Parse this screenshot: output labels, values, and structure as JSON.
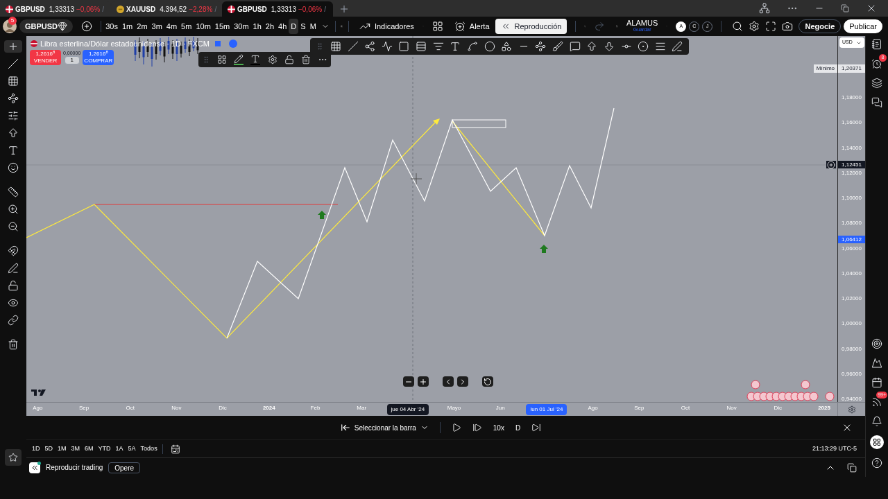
{
  "browser_tabs": [
    {
      "symbol": "GBPUSD",
      "kind": "forex",
      "price": "1,33313",
      "change": "−0,06%",
      "suffix": "/",
      "selected": false
    },
    {
      "symbol": "XAUUSD",
      "kind": "metal",
      "price": "4.394,52",
      "change": "−2,28%",
      "suffix": "/",
      "selected": false
    },
    {
      "symbol": "GBPUSD",
      "kind": "forex",
      "price": "1,33313",
      "change": "−0,06%",
      "suffix": "/",
      "selected": true
    }
  ],
  "toolbar": {
    "avatar_badge": "5",
    "symbol": "GBPUSD",
    "intervals": [
      {
        "label": "30s",
        "selected": false
      },
      {
        "label": "1m",
        "selected": false
      },
      {
        "label": "2m",
        "selected": false
      },
      {
        "label": "3m",
        "selected": false
      },
      {
        "label": "4m",
        "selected": false
      },
      {
        "label": "5m",
        "selected": false
      },
      {
        "label": "10m",
        "selected": false
      },
      {
        "label": "15m",
        "selected": false
      },
      {
        "label": "30m",
        "selected": false
      },
      {
        "label": "1h",
        "selected": false
      },
      {
        "label": "2h",
        "selected": false
      },
      {
        "label": "4h",
        "selected": false
      },
      {
        "label": "D",
        "selected": true
      },
      {
        "label": "S",
        "selected": false
      },
      {
        "label": "M",
        "selected": false
      }
    ],
    "indicators": "Indicadores",
    "alert": "Alerta",
    "replay": "Reproducción",
    "layout_name": "ALAMUS",
    "layout_status": "Guardar",
    "profiles": [
      {
        "label": "A",
        "selected": true
      },
      {
        "label": "C",
        "selected": false
      },
      {
        "label": "J",
        "selected": false
      }
    ],
    "trade": "Negocie",
    "publish": "Publicar"
  },
  "left_tools": [
    {
      "kind": "crosshair",
      "selected": true
    },
    {
      "kind": "line",
      "selected": false
    },
    {
      "kind": "grid",
      "selected": false
    },
    {
      "kind": "pattern",
      "selected": false
    },
    {
      "kind": "sliders",
      "selected": false
    },
    {
      "kind": "arrow",
      "selected": false
    },
    {
      "kind": "text",
      "selected": false
    },
    {
      "kind": "smile",
      "selected": false
    },
    {
      "kind": "ruler",
      "selected": false
    },
    {
      "kind": "zoom_in",
      "selected": false
    },
    {
      "kind": "zoom_out",
      "selected": false
    },
    {
      "kind": "magnet",
      "selected": false
    },
    {
      "kind": "pencil",
      "selected": false
    },
    {
      "kind": "lock",
      "selected": false
    },
    {
      "kind": "eye",
      "selected": false
    },
    {
      "kind": "link",
      "selected": false
    },
    {
      "kind": "trash",
      "selected": false
    }
  ],
  "legend": {
    "title": "Libra esterlina/Dólar estadounidense · 1D · FXCM",
    "sell_price": "1,2616$^{8}$",
    "sell_label": "VENDER",
    "spread": "0,00000",
    "quantity": "1",
    "buy_price": "1,2616$^{8}$",
    "buy_label": "COMPRAR"
  },
  "price_axis": {
    "currency": "USD",
    "min_label": "Mínimo",
    "min_value": "1,20371",
    "ticks": [
      "1,18000",
      "1,16000",
      "1,14000",
      "1,12000",
      "1,10000",
      "1,08000",
      "1,06000",
      "1,04000",
      "1,02000",
      "1,00000",
      "0,98000",
      "0,96000",
      "0,94000"
    ],
    "cursor_value": "1,12451",
    "last_value": "1,06412"
  },
  "time_axis": [
    {
      "label": "Ago",
      "kind": "month"
    },
    {
      "label": "Sep",
      "kind": "month"
    },
    {
      "label": "Oct",
      "kind": "month"
    },
    {
      "label": "Nov",
      "kind": "month"
    },
    {
      "label": "Dic",
      "kind": "month"
    },
    {
      "label": "2024",
      "kind": "year"
    },
    {
      "label": "Feb",
      "kind": "month"
    },
    {
      "label": "Mar",
      "kind": "month"
    },
    {
      "label": "jue 04 Abr '24",
      "kind": "cursor"
    },
    {
      "label": "Mayo",
      "kind": "month"
    },
    {
      "label": "Jun",
      "kind": "month"
    },
    {
      "label": "lun 01 Jul '24",
      "kind": "marker"
    },
    {
      "label": "Ago",
      "kind": "month"
    },
    {
      "label": "Sep",
      "kind": "month"
    },
    {
      "label": "Oct",
      "kind": "month"
    },
    {
      "label": "Nov",
      "kind": "month"
    },
    {
      "label": "Dic",
      "kind": "month"
    },
    {
      "label": "2025",
      "kind": "year"
    }
  ],
  "replay_bar": {
    "select": "Seleccionar la barra",
    "speed": "10x",
    "interval": "D"
  },
  "ranges": [
    "1D",
    "5D",
    "1M",
    "3M",
    "6M",
    "YTD",
    "1A",
    "5A",
    "Todos"
  ],
  "clock": "21:13:29 UTC-5",
  "footer": {
    "title": "Reproducir trading",
    "button": "Opere"
  },
  "sidebar": {
    "alerts_badge": "8",
    "news_badge": "99+"
  }
}
